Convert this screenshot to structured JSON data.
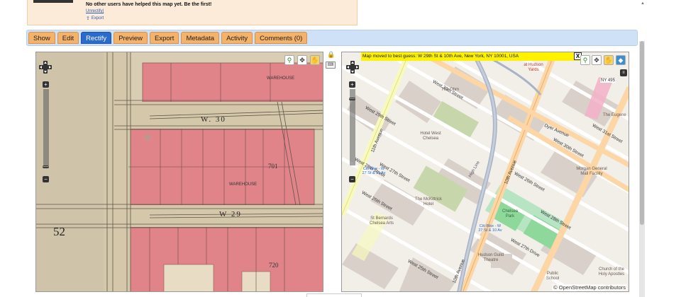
{
  "info": {
    "message": "No other users have helped this map yet. Be the first!",
    "unlink": "Unrectify|",
    "export": "Export"
  },
  "tabs": [
    {
      "label": "Show"
    },
    {
      "label": "Edit"
    },
    {
      "label": "Rectify"
    },
    {
      "label": "Preview"
    },
    {
      "label": "Export"
    },
    {
      "label": "Metadata"
    },
    {
      "label": "Activity"
    },
    {
      "label": "Comments (0)"
    }
  ],
  "active_tab": "Rectify",
  "historic_map": {
    "sheet_number": "52",
    "street_1": "W. 30",
    "street_2": "W 29",
    "label_warehouse": "WAREHOUSE",
    "label_warehouse_2": "WAREHOUSE",
    "num_701": "701",
    "num_720": "720"
  },
  "reference_map": {
    "message": "Map moved to best guess: W 29th St & 10th Ave, New York, NY 10001, USA",
    "close": "X",
    "attribution": "© OpenStreetMap contributors",
    "streets": {
      "w30": "West 30th Street",
      "w29": "West 29th Street",
      "w28": "West 28th Street",
      "w27": "West 27th Street",
      "w26": "West 26th Street",
      "w25": "West 25th Street",
      "w28b": "West 28th Street",
      "w27d": "West 27th Drive",
      "w26b": "West 26th Street",
      "w31": "West 31st Street",
      "w30b": "West 30th Street",
      "dyer": "Dyer Avenue",
      "av11": "11th Avenue",
      "av10": "10th Avenue",
      "av10b": "10th Avenue",
      "highline": "High Line",
      "ny495": "NY 495"
    },
    "places": {
      "ohm": "The Ohm",
      "west_chelsea": "Hotel West Chelsea",
      "chelsea_park": "Chelsea Park",
      "morgan": "Morgan General Mail Facility",
      "mckittrick": "The McKittrick Hotel",
      "hudson_theatre": "Hudson Guild Theatre",
      "public_school": "Public School",
      "church": "Church of the Holy Apostles",
      "st_bernards": "St Bernards Chelsea Arts",
      "eugene": "The Eugene",
      "hudson_yards": "at Hudson Yards",
      "citibike1": "Citi Bike - W 27 St & 11 Av",
      "citibike2": "Citi Bike - W 27 St & 10 Av"
    }
  },
  "colors": {
    "tab_bg": "#f5b26b",
    "tab_active": "#2a6bcc",
    "tabbar_bg": "#cfe1f6",
    "pink": "#e0848a",
    "osm_bg": "#f2efe9",
    "osm_primary": "#fcd6a4",
    "osm_yellow": "#f7fabf",
    "msg_yellow": "#fff200"
  }
}
